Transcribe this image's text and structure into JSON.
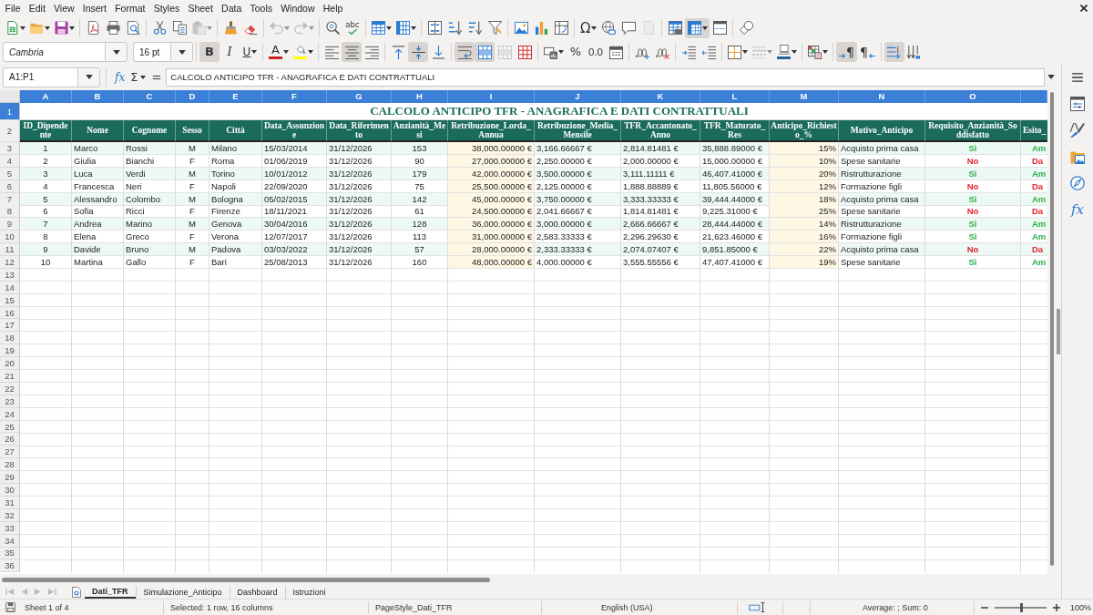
{
  "menu_bar": {
    "items": [
      "File",
      "Edit",
      "View",
      "Insert",
      "Format",
      "Styles",
      "Sheet",
      "Data",
      "Tools",
      "Window",
      "Help"
    ]
  },
  "standard_toolbar": {
    "groups": [
      {
        "buttons": [
          {
            "kind": "new",
            "on": false,
            "disabled": false,
            "dropdown": true
          },
          {
            "kind": "open",
            "on": false,
            "disabled": false,
            "dropdown": true
          },
          {
            "kind": "save",
            "on": false,
            "disabled": false,
            "dropdown": true
          }
        ]
      },
      {
        "buttons": [
          {
            "kind": "export_pdf",
            "on": false,
            "disabled": false,
            "dropdown": false
          },
          {
            "kind": "print",
            "on": false,
            "disabled": false,
            "dropdown": false
          },
          {
            "kind": "print_preview",
            "on": false,
            "disabled": false,
            "dropdown": false
          }
        ]
      },
      {
        "buttons": [
          {
            "kind": "cut",
            "on": false,
            "disabled": false,
            "dropdown": false
          },
          {
            "kind": "copy",
            "on": false,
            "disabled": false,
            "dropdown": false
          },
          {
            "kind": "paste",
            "on": false,
            "disabled": true,
            "dropdown": true
          }
        ]
      },
      {
        "buttons": [
          {
            "kind": "clone",
            "on": false,
            "disabled": false,
            "dropdown": false
          },
          {
            "kind": "clear_format",
            "on": false,
            "disabled": false,
            "dropdown": false
          }
        ]
      },
      {
        "buttons": [
          {
            "kind": "undo",
            "on": false,
            "disabled": true,
            "dropdown": true
          },
          {
            "kind": "redo",
            "on": false,
            "disabled": true,
            "dropdown": true
          }
        ]
      },
      {
        "buttons": [
          {
            "kind": "find_replace",
            "on": false,
            "disabled": false,
            "dropdown": false
          },
          {
            "kind": "spelling",
            "glyph": "abc",
            "on": false,
            "disabled": false,
            "dropdown": false
          }
        ]
      },
      {
        "buttons": [
          {
            "kind": "rows",
            "on": false,
            "disabled": false,
            "dropdown": true
          },
          {
            "kind": "columns",
            "on": false,
            "disabled": false,
            "dropdown": true
          }
        ]
      },
      {
        "buttons": [
          {
            "kind": "sort",
            "on": false,
            "disabled": false,
            "dropdown": false
          },
          {
            "kind": "sort_ascending",
            "on": false,
            "disabled": false,
            "dropdown": false
          },
          {
            "kind": "sort_descending",
            "on": false,
            "disabled": false,
            "dropdown": false
          },
          {
            "kind": "autofilter",
            "on": false,
            "disabled": false,
            "dropdown": false
          }
        ]
      },
      {
        "buttons": [
          {
            "kind": "image",
            "on": false,
            "disabled": false,
            "dropdown": false
          },
          {
            "kind": "chart",
            "on": false,
            "disabled": false,
            "dropdown": false
          },
          {
            "kind": "pivot_table",
            "on": false,
            "disabled": false,
            "dropdown": false
          }
        ]
      },
      {
        "buttons": [
          {
            "kind": "special_character",
            "glyph": "Ω",
            "on": false,
            "disabled": false,
            "dropdown": true
          },
          {
            "kind": "hyperlink",
            "on": false,
            "disabled": false,
            "dropdown": false
          },
          {
            "kind": "comment",
            "on": false,
            "disabled": false,
            "dropdown": false
          },
          {
            "kind": "headers_footers",
            "on": false,
            "disabled": true,
            "dropdown": false
          }
        ]
      },
      {
        "buttons": [
          {
            "kind": "print_area",
            "on": false,
            "disabled": false,
            "dropdown": false
          },
          {
            "kind": "freeze",
            "on": true,
            "disabled": false,
            "dropdown": true
          },
          {
            "kind": "split_window",
            "on": false,
            "disabled": false,
            "dropdown": false
          }
        ]
      },
      {
        "buttons": [
          {
            "kind": "draw_functions",
            "on": false,
            "disabled": false,
            "dropdown": false
          }
        ]
      }
    ]
  },
  "formatting_toolbar": {
    "font_name": "Cambria",
    "font_size": "16 pt",
    "groups": [
      {
        "buttons": [
          {
            "kind": "bold",
            "glyph": "B",
            "on": true,
            "disabled": false,
            "dropdown": false
          },
          {
            "kind": "italic",
            "glyph": "I",
            "on": false,
            "disabled": false,
            "dropdown": false
          },
          {
            "kind": "underline",
            "glyph": "U",
            "on": false,
            "disabled": false,
            "dropdown": true
          }
        ]
      },
      {
        "buttons": [
          {
            "kind": "font_color",
            "glyph": "A",
            "color": "#c9211e",
            "on": false,
            "disabled": false,
            "dropdown": true
          },
          {
            "kind": "highlight",
            "color": "#ffff00",
            "on": false,
            "disabled": false,
            "dropdown": true
          }
        ]
      },
      {
        "buttons": [
          {
            "kind": "align_left",
            "on": false,
            "disabled": false,
            "dropdown": false
          },
          {
            "kind": "align_center",
            "on": true,
            "disabled": false,
            "dropdown": false
          },
          {
            "kind": "align_right",
            "on": false,
            "disabled": false,
            "dropdown": false
          }
        ]
      },
      {
        "buttons": [
          {
            "kind": "align_top",
            "on": false,
            "disabled": false,
            "dropdown": false
          },
          {
            "kind": "center_vertically",
            "on": true,
            "disabled": false,
            "dropdown": false
          },
          {
            "kind": "align_bottom",
            "on": false,
            "disabled": false,
            "dropdown": false
          }
        ]
      },
      {
        "buttons": [
          {
            "kind": "wrap_text",
            "on": true,
            "disabled": false,
            "dropdown": false
          },
          {
            "kind": "merge_and_center",
            "on": true,
            "disabled": false,
            "dropdown": false
          },
          {
            "kind": "merge_cells",
            "on": false,
            "disabled": true,
            "dropdown": false
          },
          {
            "kind": "unmerge_cells",
            "on": false,
            "disabled": false,
            "dropdown": false
          }
        ]
      },
      {
        "buttons": [
          {
            "kind": "currency",
            "on": false,
            "disabled": false,
            "dropdown": true
          },
          {
            "kind": "percent",
            "glyph": "%",
            "on": false,
            "disabled": false,
            "dropdown": false
          },
          {
            "kind": "number",
            "glyph": "0.0",
            "on": false,
            "disabled": false,
            "dropdown": false
          },
          {
            "kind": "date",
            "on": false,
            "disabled": false,
            "dropdown": false
          }
        ]
      },
      {
        "buttons": [
          {
            "kind": "add_decimal",
            "on": false,
            "disabled": false,
            "dropdown": false
          },
          {
            "kind": "delete_decimal",
            "on": false,
            "disabled": false,
            "dropdown": false
          }
        ]
      },
      {
        "buttons": [
          {
            "kind": "increase_indent",
            "on": false,
            "disabled": false,
            "dropdown": false
          },
          {
            "kind": "decrease_indent",
            "on": false,
            "disabled": false,
            "dropdown": false
          }
        ]
      },
      {
        "buttons": [
          {
            "kind": "borders",
            "on": false,
            "disabled": false,
            "dropdown": true
          },
          {
            "kind": "border_style",
            "on": false,
            "disabled": true,
            "dropdown": true
          },
          {
            "kind": "border_color",
            "color": "#2a6099",
            "on": false,
            "disabled": false,
            "dropdown": true
          }
        ]
      },
      {
        "buttons": [
          {
            "kind": "conditional",
            "on": false,
            "disabled": false,
            "dropdown": true
          }
        ]
      },
      {
        "buttons": [
          {
            "kind": "left_to_right",
            "glyph": "¶",
            "on": true,
            "disabled": false,
            "dropdown": false
          },
          {
            "kind": "right_to_left",
            "glyph": "¶",
            "on": false,
            "disabled": false,
            "dropdown": false
          }
        ]
      },
      {
        "buttons": [
          {
            "kind": "text_left_to_right",
            "on": true,
            "disabled": false,
            "dropdown": false
          },
          {
            "kind": "text_top_to_bottom",
            "on": false,
            "disabled": false,
            "dropdown": false
          }
        ]
      }
    ]
  },
  "formula_bar": {
    "name_box": "A1:P1",
    "function_wizard": "fx",
    "sum": "Σ",
    "formula": "=",
    "content": "CALCOLO ANTICIPO TFR - ANAGRAFICA E DATI CONTRATTUALI"
  },
  "sidebar": {
    "items": [
      {
        "kind": "properties"
      },
      {
        "kind": "styles"
      },
      {
        "kind": "gallery"
      },
      {
        "kind": "navigator"
      },
      {
        "kind": "functions",
        "glyph": "fx"
      }
    ]
  },
  "sheet": {
    "columns": [
      {
        "letter": "A",
        "selected": true
      },
      {
        "letter": "B",
        "selected": true
      },
      {
        "letter": "C",
        "selected": true
      },
      {
        "letter": "D",
        "selected": true
      },
      {
        "letter": "E",
        "selected": true
      },
      {
        "letter": "F",
        "selected": true
      },
      {
        "letter": "G",
        "selected": true
      },
      {
        "letter": "H",
        "selected": true
      },
      {
        "letter": "I",
        "selected": true
      },
      {
        "letter": "J",
        "selected": true
      },
      {
        "letter": "K",
        "selected": true
      },
      {
        "letter": "L",
        "selected": true
      },
      {
        "letter": "M",
        "selected": true
      },
      {
        "letter": "N",
        "selected": true
      },
      {
        "letter": "O",
        "selected": true
      },
      {
        "selected": true
      }
    ],
    "row_headers": [
      {
        "label": "1",
        "selected": true
      },
      {
        "label": "2",
        "selected": false
      },
      {
        "label": "3",
        "selected": false
      },
      {
        "label": "4",
        "selected": false
      },
      {
        "label": "5",
        "selected": false
      },
      {
        "label": "6",
        "selected": false
      },
      {
        "label": "7",
        "selected": false
      },
      {
        "label": "8",
        "selected": false
      },
      {
        "label": "9",
        "selected": false
      },
      {
        "label": "10",
        "selected": false
      },
      {
        "label": "11",
        "selected": false
      },
      {
        "label": "12",
        "selected": false
      },
      {
        "label": "13",
        "selected": false
      },
      {
        "label": "14",
        "selected": false
      },
      {
        "label": "15",
        "selected": false
      },
      {
        "label": "16",
        "selected": false
      },
      {
        "label": "17",
        "selected": false
      },
      {
        "label": "18",
        "selected": false
      },
      {
        "label": "19",
        "selected": false
      },
      {
        "label": "20",
        "selected": false
      },
      {
        "label": "21",
        "selected": false
      },
      {
        "label": "22",
        "selected": false
      },
      {
        "label": "23",
        "selected": false
      },
      {
        "label": "24",
        "selected": false
      },
      {
        "label": "25",
        "selected": false
      },
      {
        "label": "26",
        "selected": false
      },
      {
        "label": "27",
        "selected": false
      },
      {
        "label": "28",
        "selected": false
      },
      {
        "label": "29",
        "selected": false
      },
      {
        "label": "30",
        "selected": false
      },
      {
        "label": "31",
        "selected": false
      },
      {
        "label": "32",
        "selected": false
      },
      {
        "label": "33",
        "selected": false
      },
      {
        "label": "34",
        "selected": false
      },
      {
        "label": "35",
        "selected": false
      },
      {
        "label": "36",
        "selected": false
      }
    ],
    "title": "CALCOLO ANTICIPO TFR - ANAGRAFICA E DATI CONTRATTUALI",
    "headers": [
      "ID_Dipendente",
      "Nome",
      "Cognome",
      "Sesso",
      "Città",
      "Data_Assunzione",
      "Data_Riferimento",
      "Anzianità_Mesi",
      "Retribuzione_Lorda_Annua",
      "Retribuzione_Media_Mensile",
      "TFR_Accantonato_Anno",
      "TFR_Maturato_Res",
      "Anticipo_Richiesto_%",
      "Motivo_Anticipo",
      "Requisito_Anzianità_Soddisfatto",
      "Esito_"
    ],
    "rows": [
      {
        "requirement_met": true,
        "cells": [
          "1",
          "Marco",
          "Rossi",
          "M",
          "Milano",
          "15/03/2014",
          "31/12/2026",
          "153",
          "38,000.00000 €",
          "3,166.66667 €",
          "2,814.81481 €",
          "35,888.89000 €",
          "15%",
          "Acquisto prima casa",
          "Sì",
          "Am"
        ]
      },
      {
        "requirement_met": false,
        "cells": [
          "2",
          "Giulia",
          "Bianchi",
          "F",
          "Roma",
          "01/06/2019",
          "31/12/2026",
          "90",
          "27,000.00000 €",
          "2,250.00000 €",
          "2,000.00000 €",
          "15,000.00000 €",
          "10%",
          "Spese sanitarie",
          "No",
          "Da"
        ]
      },
      {
        "requirement_met": true,
        "cells": [
          "3",
          "Luca",
          "Verdi",
          "M",
          "Torino",
          "10/01/2012",
          "31/12/2026",
          "179",
          "42,000.00000 €",
          "3,500.00000 €",
          "3,111.11111 €",
          "46,407.41000 €",
          "20%",
          "Ristrutturazione",
          "Sì",
          "Am"
        ]
      },
      {
        "requirement_met": false,
        "cells": [
          "4",
          "Francesca",
          "Neri",
          "F",
          "Napoli",
          "22/09/2020",
          "31/12/2026",
          "75",
          "25,500.00000 €",
          "2,125.00000 €",
          "1,888.88889 €",
          "11,805.56000 €",
          "12%",
          "Formazione figli",
          "No",
          "Da"
        ]
      },
      {
        "requirement_met": true,
        "cells": [
          "5",
          "Alessandro",
          "Colombo",
          "M",
          "Bologna",
          "05/02/2015",
          "31/12/2026",
          "142",
          "45,000.00000 €",
          "3,750.00000 €",
          "3,333.33333 €",
          "39,444.44000 €",
          "18%",
          "Acquisto prima casa",
          "Sì",
          "Am"
        ]
      },
      {
        "requirement_met": false,
        "cells": [
          "6",
          "Sofia",
          "Ricci",
          "F",
          "Firenze",
          "18/11/2021",
          "31/12/2026",
          "61",
          "24,500.00000 €",
          "2,041.66667 €",
          "1,814.81481 €",
          "9,225.31000 €",
          "25%",
          "Spese sanitarie",
          "No",
          "Da"
        ]
      },
      {
        "requirement_met": true,
        "cells": [
          "7",
          "Andrea",
          "Marino",
          "M",
          "Genova",
          "30/04/2016",
          "31/12/2026",
          "128",
          "36,000.00000 €",
          "3,000.00000 €",
          "2,666.66667 €",
          "28,444.44000 €",
          "14%",
          "Ristrutturazione",
          "Sì",
          "Am"
        ]
      },
      {
        "requirement_met": true,
        "cells": [
          "8",
          "Elena",
          "Greco",
          "F",
          "Verona",
          "12/07/2017",
          "31/12/2026",
          "113",
          "31,000.00000 €",
          "2,583.33333 €",
          "2,296.29630 €",
          "21,623.46000 €",
          "16%",
          "Formazione figli",
          "Sì",
          "Am"
        ]
      },
      {
        "requirement_met": false,
        "cells": [
          "9",
          "Davide",
          "Bruno",
          "M",
          "Padova",
          "03/03/2022",
          "31/12/2026",
          "57",
          "28,000.00000 €",
          "2,333.33333 €",
          "2,074.07407 €",
          "9,851.85000 €",
          "22%",
          "Acquisto prima casa",
          "No",
          "Da"
        ]
      },
      {
        "requirement_met": true,
        "cells": [
          "10",
          "Martina",
          "Gallo",
          "F",
          "Bari",
          "25/08/2013",
          "31/12/2026",
          "160",
          "48,000.00000 €",
          "4,000.00000 €",
          "3,555.55556 €",
          "47,407.41000 €",
          "19%",
          "Spese sanitarie",
          "Sì",
          "Am"
        ]
      }
    ]
  },
  "sheet_navigation": [
    {
      "kind": "first",
      "disabled": true
    },
    {
      "kind": "previous",
      "disabled": true
    },
    {
      "kind": "next",
      "disabled": true
    },
    {
      "kind": "last",
      "disabled": true
    }
  ],
  "sheet_tabs": [
    {
      "label": "Dati_TFR",
      "selected": true
    },
    {
      "label": "Simulazione_Anticipo",
      "selected": false
    },
    {
      "label": "Dashboard",
      "selected": false
    },
    {
      "label": "Istruzioni",
      "selected": false
    }
  ],
  "status_bar": {
    "sheet": "Sheet 1 of 4",
    "selection": "Selected: 1 row, 16 columns",
    "page_style": "PageStyle_Dati_TFR",
    "language": "English (USA)",
    "summary": "Average: ; Sum: 0",
    "zoom": {
      "level": 0.5,
      "reading": "100%"
    }
  }
}
